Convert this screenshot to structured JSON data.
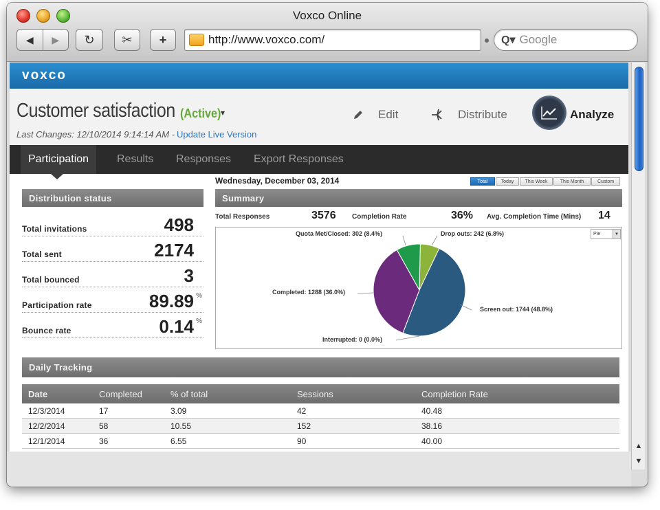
{
  "window": {
    "title": "Voxco Online"
  },
  "toolbar": {
    "back_glyph": "◀",
    "forward_glyph": "▶",
    "reload_glyph": "↻",
    "snip_glyph": "✂",
    "add_glyph": "+",
    "url": "http://www.voxco.com/",
    "search_placeholder": "Google",
    "search_glyph": "Q▾"
  },
  "brand": {
    "logo": "voxco"
  },
  "header": {
    "title": "Customer satisfaction",
    "status": "(Active)",
    "status_caret": "▾",
    "last_changes": "Last Changes: 12/10/2014 9:14:14 AM -",
    "update_link": "Update Live Version",
    "actions": {
      "edit": "Edit",
      "distribute": "Distribute",
      "analyze": "Analyze"
    },
    "icons": {
      "edit": "pencil-icon",
      "distribute": "fork-icon",
      "analyze": "line-chart-icon"
    }
  },
  "tabs": [
    {
      "label": "Participation",
      "active": true
    },
    {
      "label": "Results",
      "active": false
    },
    {
      "label": "Responses",
      "active": false
    },
    {
      "label": "Export Responses",
      "active": false
    }
  ],
  "distribution": {
    "heading": "Distribution status",
    "metrics": [
      {
        "label": "Total invitations",
        "value": "498",
        "sup": ""
      },
      {
        "label": "Total sent",
        "value": "2174",
        "sup": ""
      },
      {
        "label": "Total bounced",
        "value": "3",
        "sup": ""
      },
      {
        "label": "Participation rate",
        "value": "89.89",
        "sup": "%"
      },
      {
        "label": "Bounce rate",
        "value": "0.14",
        "sup": "%"
      }
    ]
  },
  "summary": {
    "date": "Wednesday, December 03, 2014",
    "ranges": [
      {
        "label": "Total",
        "active": true
      },
      {
        "label": "Today",
        "active": false
      },
      {
        "label": "This Week",
        "active": false
      },
      {
        "label": "This Month",
        "active": false
      },
      {
        "label": "Custom",
        "active": false
      }
    ],
    "heading": "Summary",
    "total_responses_label": "Total Responses",
    "total_responses": "3576",
    "completion_rate_label": "Completion Rate",
    "completion_rate": "36%",
    "avg_time_label": "Avg. Completion Time (Mins)",
    "avg_time": "14",
    "chart_type_select": "Pie"
  },
  "chart_data": {
    "type": "pie",
    "slices": [
      {
        "label": "Drop outs: 242 (6.8%)",
        "value": 242,
        "percent": 6.8,
        "color": "#8db43a"
      },
      {
        "label": "Screen out: 1744 (48.8%)",
        "value": 1744,
        "percent": 48.8,
        "color": "#2a5a80"
      },
      {
        "label": "Interrupted: 0 (0.0%)",
        "value": 0,
        "percent": 0.0,
        "color": "#999999"
      },
      {
        "label": "Completed: 1288 (36.0%)",
        "value": 1288,
        "percent": 36.0,
        "color": "#6b2a7c"
      },
      {
        "label": "Quota Met/Closed: 302 (8.4%)",
        "value": 302,
        "percent": 8.4,
        "color": "#1f9a4a"
      }
    ]
  },
  "tracking": {
    "heading": "Daily Tracking",
    "columns": [
      "Date",
      "Completed",
      "% of total",
      "Sessions",
      "Completion Rate"
    ],
    "rows": [
      [
        "12/3/2014",
        "17",
        "3.09",
        "42",
        "40.48"
      ],
      [
        "12/2/2014",
        "58",
        "10.55",
        "152",
        "38.16"
      ],
      [
        "12/1/2014",
        "36",
        "6.55",
        "90",
        "40.00"
      ]
    ]
  },
  "scrollbar": {
    "up": "▲",
    "down": "▼"
  }
}
